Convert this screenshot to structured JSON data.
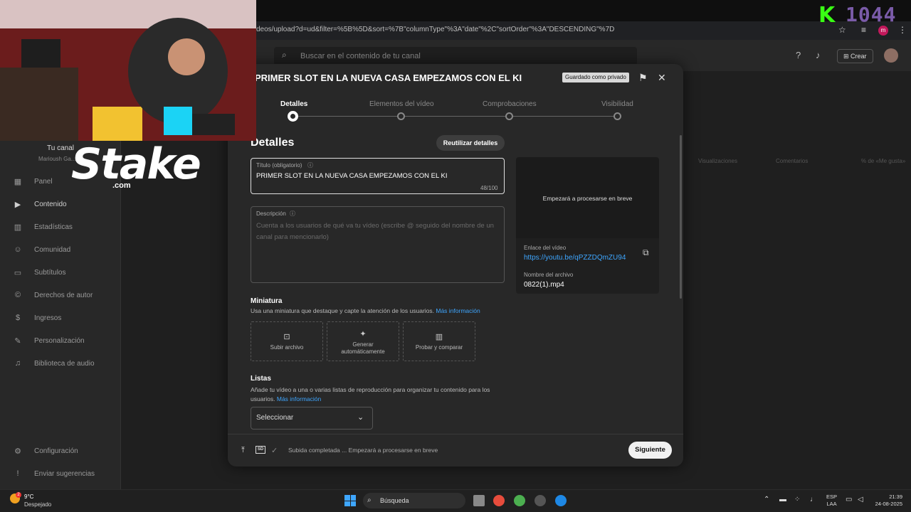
{
  "browser": {
    "url": "deos/upload?d=ud&filter=%5B%5D&sort=%7B\"columnType\"%3A\"date\"%2C\"sortOrder\"%3A\"DESCENDING\"%7D",
    "profile_initial": "m"
  },
  "overlay": {
    "sponsor_logo": "Stake",
    "sponsor_domain": ".com",
    "counter_letter": "K",
    "counter_value": "1044"
  },
  "studio": {
    "search_placeholder": "Buscar en el contenido de tu canal",
    "create_label": "Crear"
  },
  "sidebar": {
    "channel_title": "Tu canal",
    "channel_name": "Marioush Ga...",
    "items": [
      {
        "label": "Panel",
        "icon": "dashboard-icon"
      },
      {
        "label": "Contenido",
        "icon": "content-icon"
      },
      {
        "label": "Estadísticas",
        "icon": "analytics-icon"
      },
      {
        "label": "Comunidad",
        "icon": "community-icon"
      },
      {
        "label": "Subtítulos",
        "icon": "subtitles-icon"
      },
      {
        "label": "Derechos de autor",
        "icon": "copyright-icon"
      },
      {
        "label": "Ingresos",
        "icon": "earn-icon"
      },
      {
        "label": "Personalización",
        "icon": "customization-icon"
      },
      {
        "label": "Biblioteca de audio",
        "icon": "audio-library-icon"
      }
    ],
    "settings": "Configuración",
    "feedback": "Enviar sugerencias"
  },
  "background_table": {
    "columns": [
      "Visualizaciones",
      "Comentarios",
      "% de «Me gusta»"
    ]
  },
  "dialog": {
    "title": "PRIMER SLOT EN LA NUEVA CASA EMPEZAMOS CON EL KI",
    "saved_badge": "Guardado como privado",
    "steps": [
      "Detalles",
      "Elementos del vídeo",
      "Comprobaciones",
      "Visibilidad"
    ],
    "active_step": 0,
    "section_heading": "Detalles",
    "reuse_button": "Reutilizar detalles",
    "title_field": {
      "label": "Título (obligatorio)",
      "value": "PRIMER SLOT EN LA NUEVA CASA EMPEZAMOS CON EL KI",
      "counter": "48/100"
    },
    "description_field": {
      "label": "Descripción",
      "placeholder": "Cuenta a los usuarios de qué va tu vídeo (escribe @ seguido del nombre de un canal para mencionarlo)"
    },
    "thumbnail": {
      "heading": "Miniatura",
      "help": "Usa una miniatura que destaque y capte la atención de los usuarios.",
      "help_link": "Más información",
      "options": [
        "Subir archivo",
        "Generar automáticamente",
        "Probar y comparar"
      ]
    },
    "playlists": {
      "heading": "Listas",
      "help": "Añade tu vídeo a una o varias listas de reproducción para organizar tu contenido para los usuarios.",
      "help_link": "Más información",
      "select_value": "Seleccionar"
    },
    "preview": {
      "processing_text": "Empezará a procesarse en breve",
      "link_label": "Enlace del vídeo",
      "link_value": "https://youtu.be/qPZZDQmZU94",
      "file_label": "Nombre del archivo",
      "file_value": "0822(1).mp4"
    },
    "footer": {
      "quality_badge": "SD",
      "status": "Subida completada ... Empezará a procesarse en breve",
      "next_button": "Siguiente"
    }
  },
  "taskbar": {
    "weather_temp": "9°C",
    "weather_desc": "Despejado",
    "weather_alert": "2",
    "search_label": "Búsqueda",
    "lang_line1": "ESP",
    "lang_line2": "LAA",
    "time": "21:39",
    "date": "24-08-2025"
  }
}
